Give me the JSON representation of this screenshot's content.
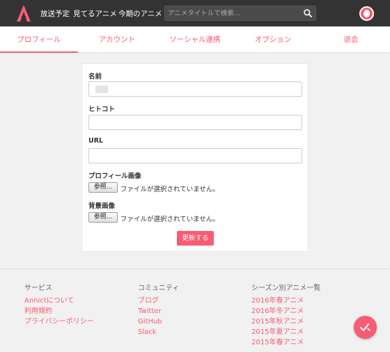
{
  "header": {
    "nav": [
      "放送予定",
      "見てるアニメ",
      "今期のアニメ"
    ],
    "search_placeholder": "アニメタイトルで検索...",
    "brand_color": "#f85b73"
  },
  "tabs": [
    "プロフィール",
    "アカウント",
    "ソーシャル連携",
    "オプション",
    "退会"
  ],
  "form": {
    "name_label": "名前",
    "hitokoto_label": "ヒトコト",
    "url_label": "URL",
    "profile_image_label": "プロフィール画像",
    "background_image_label": "背景画像",
    "browse_button": "参照...",
    "no_file_text": "ファイルが選択されていません。",
    "submit_label": "更新する"
  },
  "footer": {
    "service": {
      "heading": "サービス",
      "links": [
        "Annictについて",
        "利用規約",
        "プライバシーポリシー"
      ]
    },
    "community": {
      "heading": "コミュニティ",
      "links": [
        "ブログ",
        "Twitter",
        "GitHub",
        "Slack"
      ]
    },
    "seasons": {
      "heading": "シーズン別アニメ一覧",
      "links": [
        "2016年春アニメ",
        "2016年冬アニメ",
        "2015年秋アニメ",
        "2015年夏アニメ",
        "2015年春アニメ"
      ]
    }
  },
  "icons": {
    "logo": "annict-logo-icon",
    "search": "search-icon",
    "avatar": "user-avatar",
    "fab": "check-record-icon"
  }
}
